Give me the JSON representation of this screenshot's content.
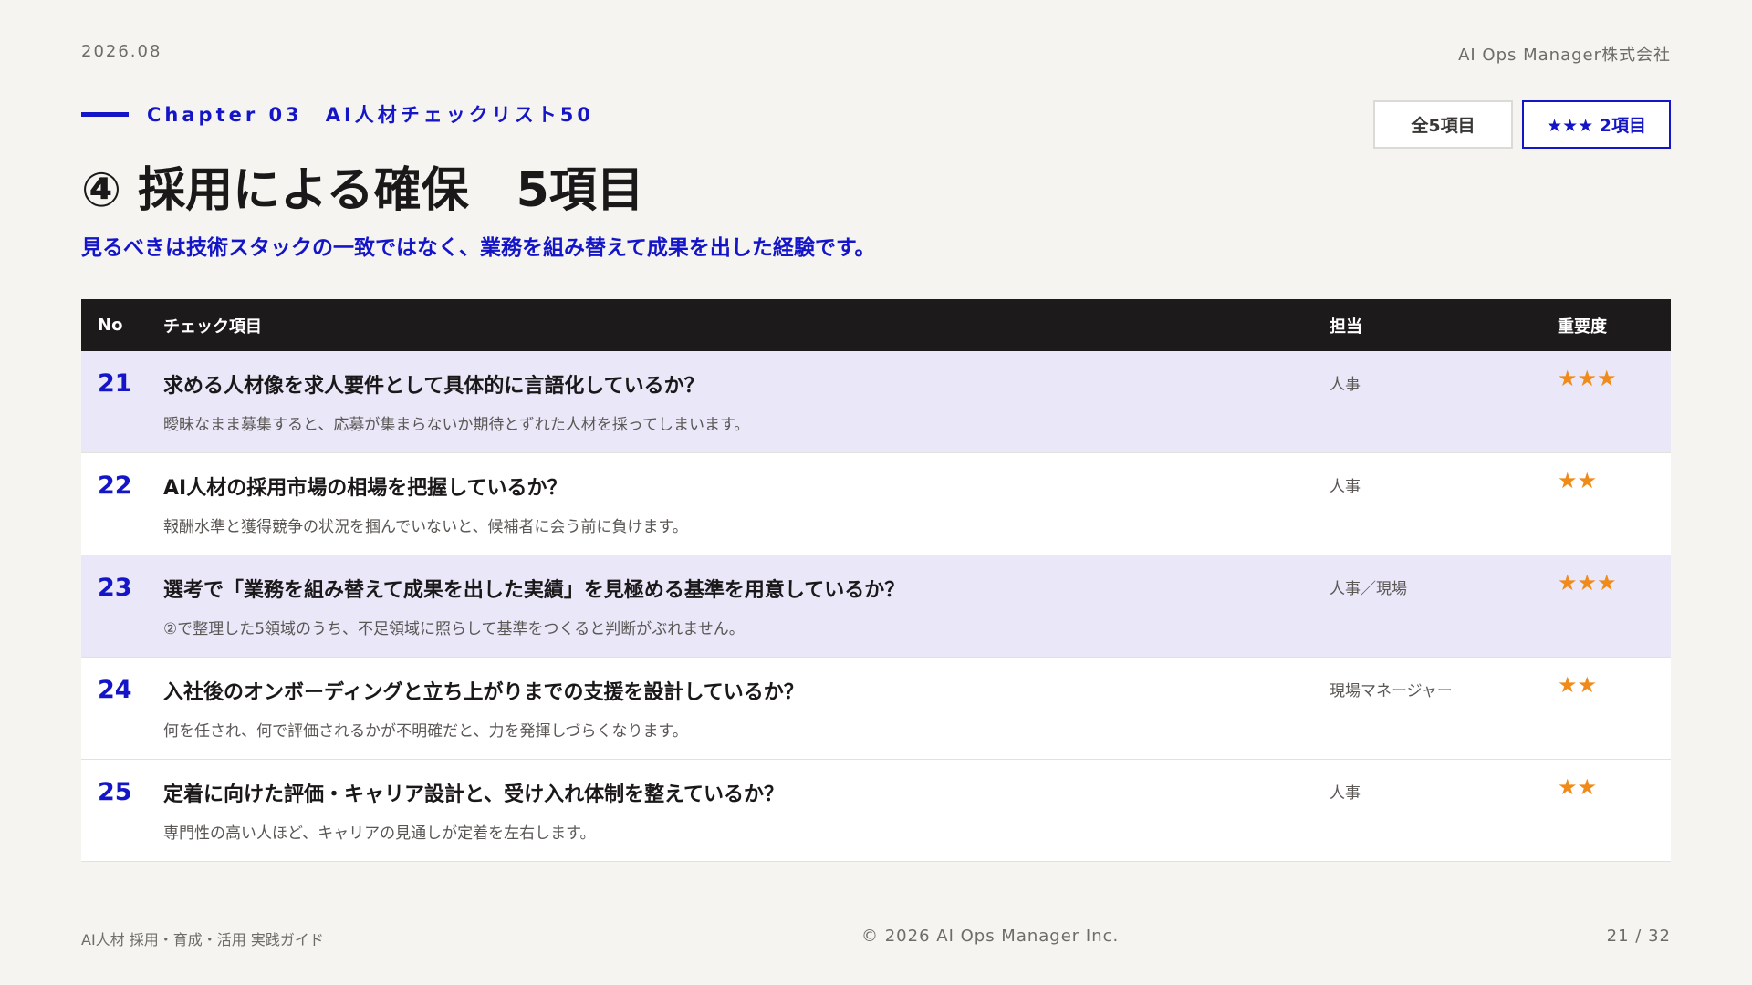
{
  "header": {
    "date": "2026.08",
    "company": "AI Ops Manager株式会社"
  },
  "chapter": {
    "label": "Chapter 03　AI人材チェックリスト50"
  },
  "badges": {
    "all": "全5項目",
    "star": "★★★ 2項目"
  },
  "title": "④ 採用による確保　5項目",
  "subtitle": "見るべきは技術スタックの一致ではなく、業務を組み替えて成果を出した経験です。",
  "table": {
    "headers": {
      "no": "No",
      "item": "チェック項目",
      "owner": "担当",
      "importance": "重要度"
    },
    "rows": [
      {
        "no": "21",
        "title": "求める人材像を求人要件として具体的に言語化しているか？",
        "desc": "曖昧なまま募集すると、応募が集まらないか期待とずれた人材を採ってしまいます。",
        "owner": "人事",
        "importance": "★★★"
      },
      {
        "no": "22",
        "title": "AI人材の採用市場の相場を把握しているか？",
        "desc": "報酬水準と獲得競争の状況を掴んでいないと、候補者に会う前に負けます。",
        "owner": "人事",
        "importance": "★★"
      },
      {
        "no": "23",
        "title": "選考で「業務を組み替えて成果を出した実績」を見極める基準を用意しているか？",
        "desc": "②で整理した5領域のうち、不足領域に照らして基準をつくると判断がぶれません。",
        "owner": "人事／現場",
        "importance": "★★★"
      },
      {
        "no": "24",
        "title": "入社後のオンボーディングと立ち上がりまでの支援を設計しているか？",
        "desc": "何を任され、何で評価されるかが不明確だと、力を発揮しづらくなります。",
        "owner": "現場マネージャー",
        "importance": "★★"
      },
      {
        "no": "25",
        "title": "定着に向けた評価・キャリア設計と、受け入れ体制を整えているか？",
        "desc": "専門性の高い人ほど、キャリアの見通しが定着を左右します。",
        "owner": "人事",
        "importance": "★★"
      }
    ]
  },
  "footer": {
    "left": "AI人材 採用・育成・活用 実践ガイド",
    "center": "© 2026 AI Ops Manager Inc.",
    "right": "21 / 32"
  },
  "colors": {
    "accent": "#1515c8",
    "star": "#f08a18",
    "header_bg": "#1c1a1a",
    "highlight_row": "#e9e7f8"
  }
}
